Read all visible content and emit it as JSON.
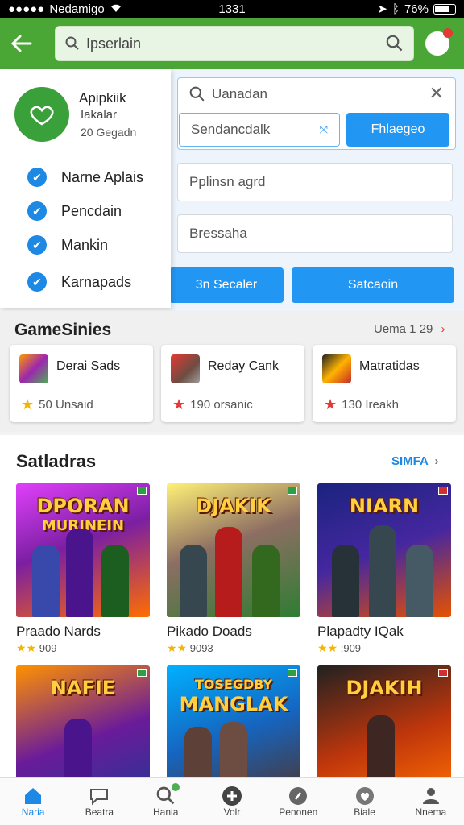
{
  "status_bar": {
    "carrier": "Nedamigo",
    "time": "1331",
    "battery": "76%"
  },
  "header": {
    "search_text": "Ipserlain"
  },
  "drawer": {
    "app_name": "Apipkiik",
    "app_sub": "Iakalar",
    "app_count": "20 Gegadn",
    "items": [
      {
        "label": "Narne Aplais"
      },
      {
        "label": "Pencdain"
      },
      {
        "label": "Mankin"
      },
      {
        "label": "Karnapads"
      }
    ]
  },
  "form": {
    "search_placeholder": "Uanadan",
    "field_1": "Sendancdalk",
    "primary_button": "Fhlaegeo",
    "field_2": "Pplinsn agrd",
    "field_3": "Bressaha",
    "button_left": "3n Secaler",
    "button_right": "Satcaoin"
  },
  "games": {
    "title": "GameSinies",
    "link": "Uema 1 29",
    "cards": [
      {
        "name": "Derai Sads",
        "rating": "50 Unsaid",
        "star_color": "#f5b400"
      },
      {
        "name": "Reday Cank",
        "rating": "190 orsanic",
        "star_color": "#e53935"
      },
      {
        "name": "Matratidas",
        "rating": "130 Ireakh",
        "star_color": "#e53935"
      }
    ]
  },
  "featured": {
    "title": "Satladras",
    "link": "SIMFA",
    "tiles": [
      {
        "art_title": "DPORAN",
        "art_sub": "MURINEIN",
        "name": "Praado Nards",
        "stars": "★★",
        "rating": "909"
      },
      {
        "art_title": "DJAKIK",
        "art_sub": "",
        "name": "Pikado Doads",
        "stars": "★★",
        "rating": "9093"
      },
      {
        "art_title": "NIARN",
        "art_sub": "",
        "name": "Plapadty IQak",
        "stars": "★★",
        "rating": ":909"
      },
      {
        "art_title": "NAFIE",
        "art_sub": "",
        "name": "",
        "stars": "",
        "rating": ""
      },
      {
        "art_title": "TOSEGDBY",
        "art_sub": "MANGLAK",
        "name": "",
        "stars": "",
        "rating": ""
      },
      {
        "art_title": "DJAKIH",
        "art_sub": "",
        "name": "",
        "stars": "",
        "rating": ""
      }
    ]
  },
  "bottom_nav": [
    {
      "label": "Naria",
      "icon": "home-icon"
    },
    {
      "label": "Beatra",
      "icon": "chat-icon"
    },
    {
      "label": "Hania",
      "icon": "search-icon"
    },
    {
      "label": "Volr",
      "icon": "add-icon"
    },
    {
      "label": "Penonen",
      "icon": "pin-icon"
    },
    {
      "label": "Biale",
      "icon": "heart-icon"
    },
    {
      "label": "Nnema",
      "icon": "profile-icon"
    }
  ],
  "colors": {
    "header_green": "#4aa736",
    "accent_blue": "#2196f3",
    "star_gold": "#f5b400"
  }
}
